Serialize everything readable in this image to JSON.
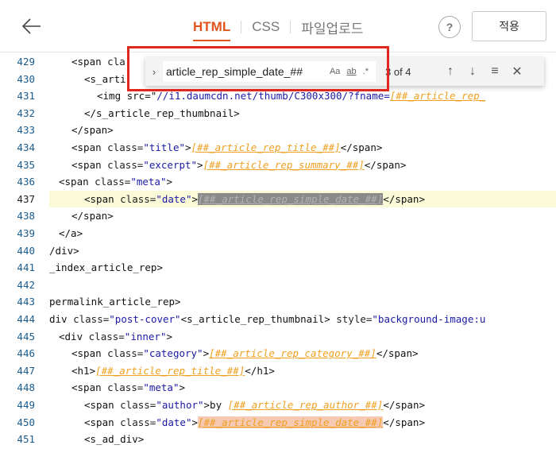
{
  "header": {
    "back_icon": "arrow-left-icon",
    "tabs": [
      {
        "label": "HTML",
        "active": true
      },
      {
        "label": "CSS",
        "active": false
      },
      {
        "label": "파일업로드",
        "active": false
      }
    ],
    "help_label": "?",
    "apply_label": "적용",
    "accent": "#e4541e"
  },
  "find": {
    "query": "article_rep_simple_date_##",
    "match_case": "Aa",
    "whole_word": "ab",
    "regex": ".*",
    "count": "3 of 4",
    "toggle_icon": "chevron-right-icon",
    "prev_icon": "arrow-up-icon",
    "next_icon": "arrow-down-icon",
    "selection_icon": "find-in-selection-icon",
    "close_icon": "close-icon"
  },
  "editor": {
    "current_line": 437,
    "lines": [
      {
        "n": "429",
        "parts": [
          [
            "t",
            "<span "
          ],
          [
            "a",
            "cla"
          ]
        ]
      },
      {
        "n": "430",
        "parts": [
          [
            "t",
            "<s_arti"
          ]
        ]
      },
      {
        "n": "431",
        "parts": [
          [
            "t",
            "<img src=\""
          ],
          [
            "s",
            "//i1.daumcdn.net/thumb/C300x300/?fname="
          ],
          [
            "v",
            "[##_article_rep_"
          ]
        ]
      },
      {
        "n": "432",
        "parts": [
          [
            "t",
            "</s_article_rep_thumbnail>"
          ]
        ]
      },
      {
        "n": "433",
        "parts": [
          [
            "t",
            "</span>"
          ]
        ]
      },
      {
        "n": "434",
        "parts": [
          [
            "t",
            "<span "
          ],
          [
            "a",
            "class="
          ],
          [
            "s",
            "\"title\""
          ],
          [
            "t",
            ">"
          ],
          [
            "v",
            "[##_article_rep_title_##]"
          ],
          [
            "t",
            "</span>"
          ]
        ]
      },
      {
        "n": "435",
        "parts": [
          [
            "t",
            "<span "
          ],
          [
            "a",
            "class="
          ],
          [
            "s",
            "\"excerpt\""
          ],
          [
            "t",
            ">"
          ],
          [
            "v",
            "[##_article_rep_summary_##]"
          ],
          [
            "t",
            "</span>"
          ]
        ]
      },
      {
        "n": "436",
        "parts": [
          [
            "t",
            "<span "
          ],
          [
            "a",
            "class="
          ],
          [
            "s",
            "\"meta\""
          ],
          [
            "t",
            ">"
          ]
        ]
      },
      {
        "n": "437",
        "parts": [
          [
            "t",
            "<span "
          ],
          [
            "a",
            "class="
          ],
          [
            "s",
            "\"date\""
          ],
          [
            "t",
            ">"
          ],
          [
            "h",
            "[##_article_rep_simple_date_##]"
          ],
          [
            "t",
            "</span>"
          ]
        ]
      },
      {
        "n": "438",
        "parts": [
          [
            "t",
            "</span>"
          ]
        ]
      },
      {
        "n": "439",
        "parts": [
          [
            "t",
            "</a>"
          ]
        ]
      },
      {
        "n": "440",
        "parts": [
          [
            "t",
            "/div>"
          ]
        ]
      },
      {
        "n": "441",
        "parts": [
          [
            "t",
            "_index_article_rep>"
          ]
        ]
      },
      {
        "n": "442",
        "parts": []
      },
      {
        "n": "443",
        "parts": [
          [
            "t",
            "permalink_article_rep>"
          ]
        ]
      },
      {
        "n": "444",
        "parts": [
          [
            "t",
            "div "
          ],
          [
            "a",
            "class="
          ],
          [
            "s",
            "\"post-cover\""
          ],
          [
            "t",
            "<s_article_rep_thumbnail> "
          ],
          [
            "a",
            "style="
          ],
          [
            "s",
            "\"background-image:u"
          ]
        ]
      },
      {
        "n": "445",
        "parts": [
          [
            "t",
            "<div "
          ],
          [
            "a",
            "class="
          ],
          [
            "s",
            "\"inner\""
          ],
          [
            "t",
            ">"
          ]
        ]
      },
      {
        "n": "446",
        "parts": [
          [
            "t",
            "<span "
          ],
          [
            "a",
            "class="
          ],
          [
            "s",
            "\"category\""
          ],
          [
            "t",
            ">"
          ],
          [
            "v",
            "[##_article_rep_category_##]"
          ],
          [
            "t",
            "</span>"
          ]
        ]
      },
      {
        "n": "447",
        "parts": [
          [
            "t",
            "<h1>"
          ],
          [
            "v",
            "[##_article_rep_title_##]"
          ],
          [
            "t",
            "</h1>"
          ]
        ]
      },
      {
        "n": "448",
        "parts": [
          [
            "t",
            "<span "
          ],
          [
            "a",
            "class="
          ],
          [
            "s",
            "\"meta\""
          ],
          [
            "t",
            ">"
          ]
        ]
      },
      {
        "n": "449",
        "parts": [
          [
            "t",
            "<span "
          ],
          [
            "a",
            "class="
          ],
          [
            "s",
            "\"author\""
          ],
          [
            "t",
            ">by "
          ],
          [
            "v",
            "[##_article_rep_author_##]"
          ],
          [
            "t",
            "</span>"
          ]
        ]
      },
      {
        "n": "450",
        "parts": [
          [
            "t",
            "<span "
          ],
          [
            "a",
            "class="
          ],
          [
            "s",
            "\"date\""
          ],
          [
            "t",
            ">"
          ],
          [
            "p",
            "[##_article_rep_simple_date_##]"
          ],
          [
            "t",
            "</span>"
          ]
        ]
      },
      {
        "n": "451",
        "parts": [
          [
            "t",
            "<s_ad_div>"
          ]
        ]
      }
    ]
  }
}
